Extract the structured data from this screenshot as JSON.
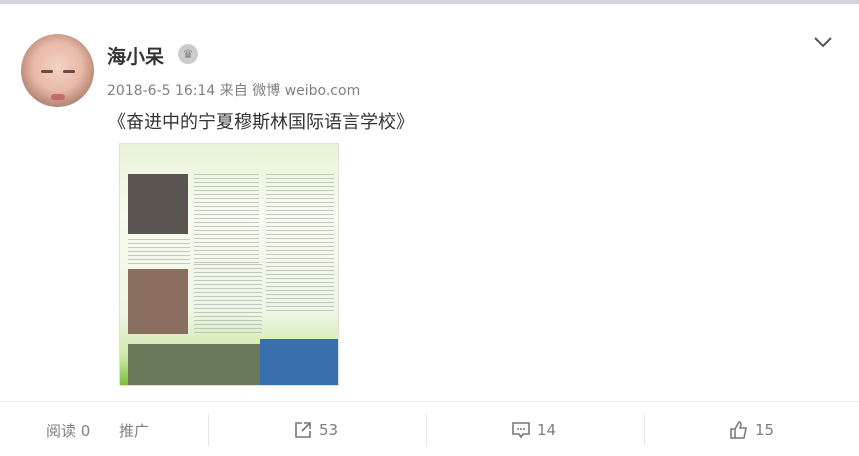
{
  "post": {
    "author": "海小呆",
    "timestamp": "2018-6-5 16:14",
    "source_prefix": "来自",
    "source": "微博 weibo.com",
    "text": "《奋进中的宁夏穆斯林国际语言学校》"
  },
  "footer": {
    "reads_label": "阅读 0",
    "promote_label": "推广",
    "reposts": "53",
    "comments": "14",
    "likes": "15"
  }
}
